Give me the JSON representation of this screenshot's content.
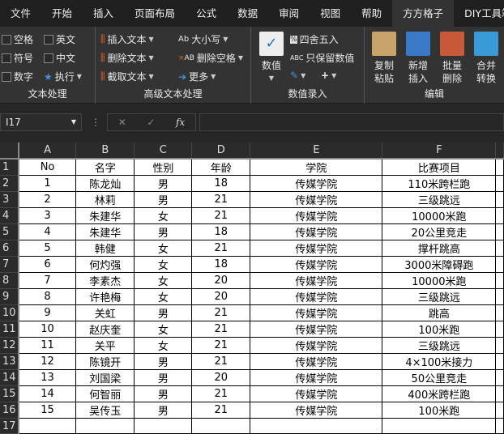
{
  "tabs": [
    "文件",
    "开始",
    "插入",
    "页面布局",
    "公式",
    "数据",
    "审阅",
    "视图",
    "帮助",
    "方方格子",
    "DIY工具箱"
  ],
  "ribbon": {
    "text_group": {
      "label": "文本处理",
      "items": [
        "空格",
        "英文",
        "符号",
        "中文",
        "数字",
        "执行"
      ]
    },
    "adv_group": {
      "label": "高级文本处理",
      "items": [
        "插入文本",
        "删除文本",
        "截取文本",
        "大小写",
        "删除空格",
        "更多"
      ]
    },
    "num_group": {
      "label": "数值录入",
      "big": "数值",
      "items": [
        "四舍五入",
        "只保留数值",
        "+"
      ]
    },
    "edit_group": {
      "label": "编辑",
      "items": [
        "复制粘贴",
        "新增插入",
        "批量删除",
        "合并转换"
      ]
    }
  },
  "formula_bar": {
    "name_box": "I17",
    "cancel": "✕",
    "enter": "✓",
    "fx": "fx",
    "value": ""
  },
  "columns": [
    "A",
    "B",
    "C",
    "D",
    "E",
    "F"
  ],
  "rows": [
    [
      "No",
      "名字",
      "性别",
      "年龄",
      "学院",
      "比赛项目"
    ],
    [
      "1",
      "陈龙灿",
      "男",
      "18",
      "传媒学院",
      "110米跨栏跑"
    ],
    [
      "2",
      "林莉",
      "男",
      "21",
      "传媒学院",
      "三级跳远"
    ],
    [
      "3",
      "朱建华",
      "女",
      "21",
      "传媒学院",
      "10000米跑"
    ],
    [
      "4",
      "朱建华",
      "男",
      "18",
      "传媒学院",
      "20公里竞走"
    ],
    [
      "5",
      "韩健",
      "女",
      "21",
      "传媒学院",
      "撑杆跳高"
    ],
    [
      "6",
      "何灼强",
      "女",
      "18",
      "传媒学院",
      "3000米障碍跑"
    ],
    [
      "7",
      "李素杰",
      "女",
      "20",
      "传媒学院",
      "10000米跑"
    ],
    [
      "8",
      "许艳梅",
      "女",
      "20",
      "传媒学院",
      "三级跳远"
    ],
    [
      "9",
      "关虹",
      "男",
      "21",
      "传媒学院",
      "跳高"
    ],
    [
      "10",
      "赵庆奎",
      "女",
      "21",
      "传媒学院",
      "100米跑"
    ],
    [
      "11",
      "关平",
      "女",
      "21",
      "传媒学院",
      "三级跳远"
    ],
    [
      "12",
      "陈镜开",
      "男",
      "21",
      "传媒学院",
      "4×100米接力"
    ],
    [
      "13",
      "刘国梁",
      "男",
      "20",
      "传媒学院",
      "50公里竞走"
    ],
    [
      "14",
      "何智丽",
      "男",
      "21",
      "传媒学院",
      "400米跨栏跑"
    ],
    [
      "15",
      "吴传玉",
      "男",
      "21",
      "传媒学院",
      "100米跑"
    ],
    [
      "",
      "",
      "",
      "",
      "",
      ""
    ]
  ]
}
